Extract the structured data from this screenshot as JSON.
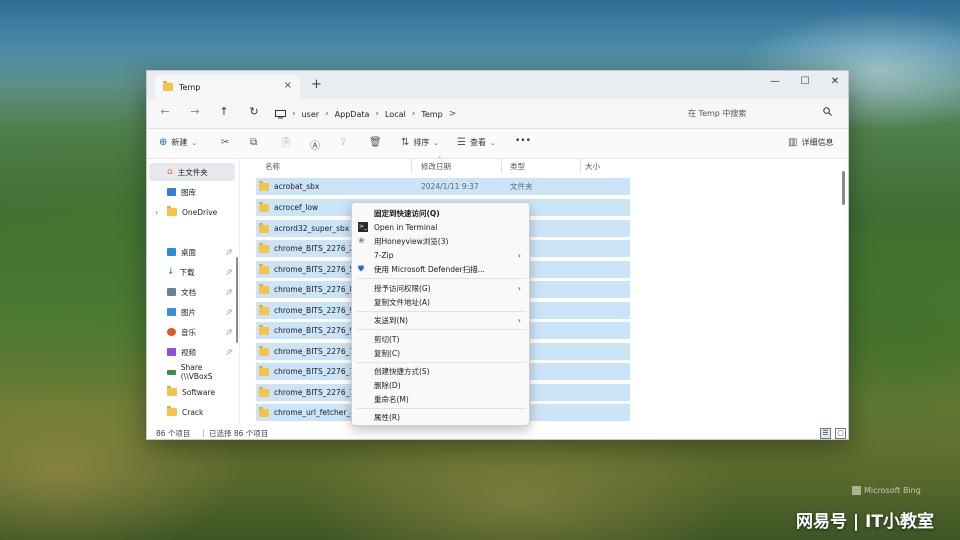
{
  "tab": {
    "title": "Temp",
    "close": "×",
    "new_tab": "+"
  },
  "window_controls": {
    "minimize": "—",
    "maximize": "☐",
    "close": "✕"
  },
  "address": {
    "back": "←",
    "forward": "→",
    "up": "↑",
    "refresh": "↻",
    "more": ">",
    "segments": [
      "user",
      "AppData",
      "Local",
      "Temp"
    ],
    "search_placeholder": "在 Temp 中搜索"
  },
  "toolbar": {
    "new_label": "新建",
    "sort_label": "排序",
    "view_label": "查看",
    "more_label": "•••",
    "details_label": "详细信息"
  },
  "sidebar": {
    "items": [
      {
        "label": "主文件夹",
        "icon": "home-icon"
      },
      {
        "label": "图库",
        "icon": "gallery-icon"
      },
      {
        "label": "OneDrive",
        "icon": "folder-icon"
      },
      {
        "label": "桌面",
        "icon": "desktop-icon"
      },
      {
        "label": "下载",
        "icon": "download-icon"
      },
      {
        "label": "文档",
        "icon": "document-icon"
      },
      {
        "label": "图片",
        "icon": "pictures-icon"
      },
      {
        "label": "音乐",
        "icon": "music-icon"
      },
      {
        "label": "视频",
        "icon": "video-icon"
      },
      {
        "label": "Share (\\\\VBoxS",
        "icon": "network-drive-icon"
      },
      {
        "label": "Software",
        "icon": "folder-icon"
      },
      {
        "label": "Crack",
        "icon": "folder-icon"
      }
    ]
  },
  "columns": {
    "name": "名称",
    "date": "修改日期",
    "type": "类型",
    "size": "大小"
  },
  "files": [
    {
      "name": "acrobat_sbx",
      "date": "2024/1/11 9:37",
      "type": "文件夹"
    },
    {
      "name": "acrocef_low",
      "date": "",
      "type": ""
    },
    {
      "name": "acrord32_super_sbx",
      "date": "",
      "type": ""
    },
    {
      "name": "chrome_BITS_2276_25",
      "date": "",
      "type": ""
    },
    {
      "name": "chrome_BITS_2276_59",
      "date": "",
      "type": ""
    },
    {
      "name": "chrome_BITS_2276_82",
      "date": "",
      "type": ""
    },
    {
      "name": "chrome_BITS_2276_96",
      "date": "",
      "type": ""
    },
    {
      "name": "chrome_BITS_2276_99",
      "date": "",
      "type": ""
    },
    {
      "name": "chrome_BITS_2276_12",
      "date": "",
      "type": ""
    },
    {
      "name": "chrome_BITS_2276_15",
      "date": "",
      "type": ""
    },
    {
      "name": "chrome_BITS_2276_16",
      "date": "",
      "type": ""
    },
    {
      "name": "chrome_url_fetcher_44",
      "date": "",
      "type": ""
    }
  ],
  "status": {
    "count": "86 个项目",
    "selected": "已选择 86 个项目"
  },
  "context_menu": {
    "items": [
      {
        "label": "固定到快速访问(Q)",
        "bold": true
      },
      {
        "label": "Open in Terminal",
        "icon": "terminal-icon"
      },
      {
        "label": "用Honeyview浏览(3)",
        "icon": "honeyview-icon"
      },
      {
        "label": "7-Zip",
        "submenu": true
      },
      {
        "label": "使用 Microsoft Defender扫描...",
        "icon": "defender-shield-icon"
      },
      {
        "label": "授予访问权限(G)",
        "submenu": true
      },
      {
        "label": "复制文件地址(A)"
      },
      {
        "label": "发送到(N)",
        "submenu": true
      },
      {
        "label": "剪切(T)"
      },
      {
        "label": "复制(C)"
      },
      {
        "label": "创建快捷方式(S)"
      },
      {
        "label": "删除(D)"
      },
      {
        "label": "重命名(M)"
      },
      {
        "label": "属性(R)"
      }
    ]
  },
  "watermarks": {
    "bing": "Microsoft Bing",
    "brand": "网易号 | IT小教室"
  },
  "colors": {
    "selection": "#cce4f7",
    "folder": "#f3c34b",
    "accent": "#0067c0"
  }
}
